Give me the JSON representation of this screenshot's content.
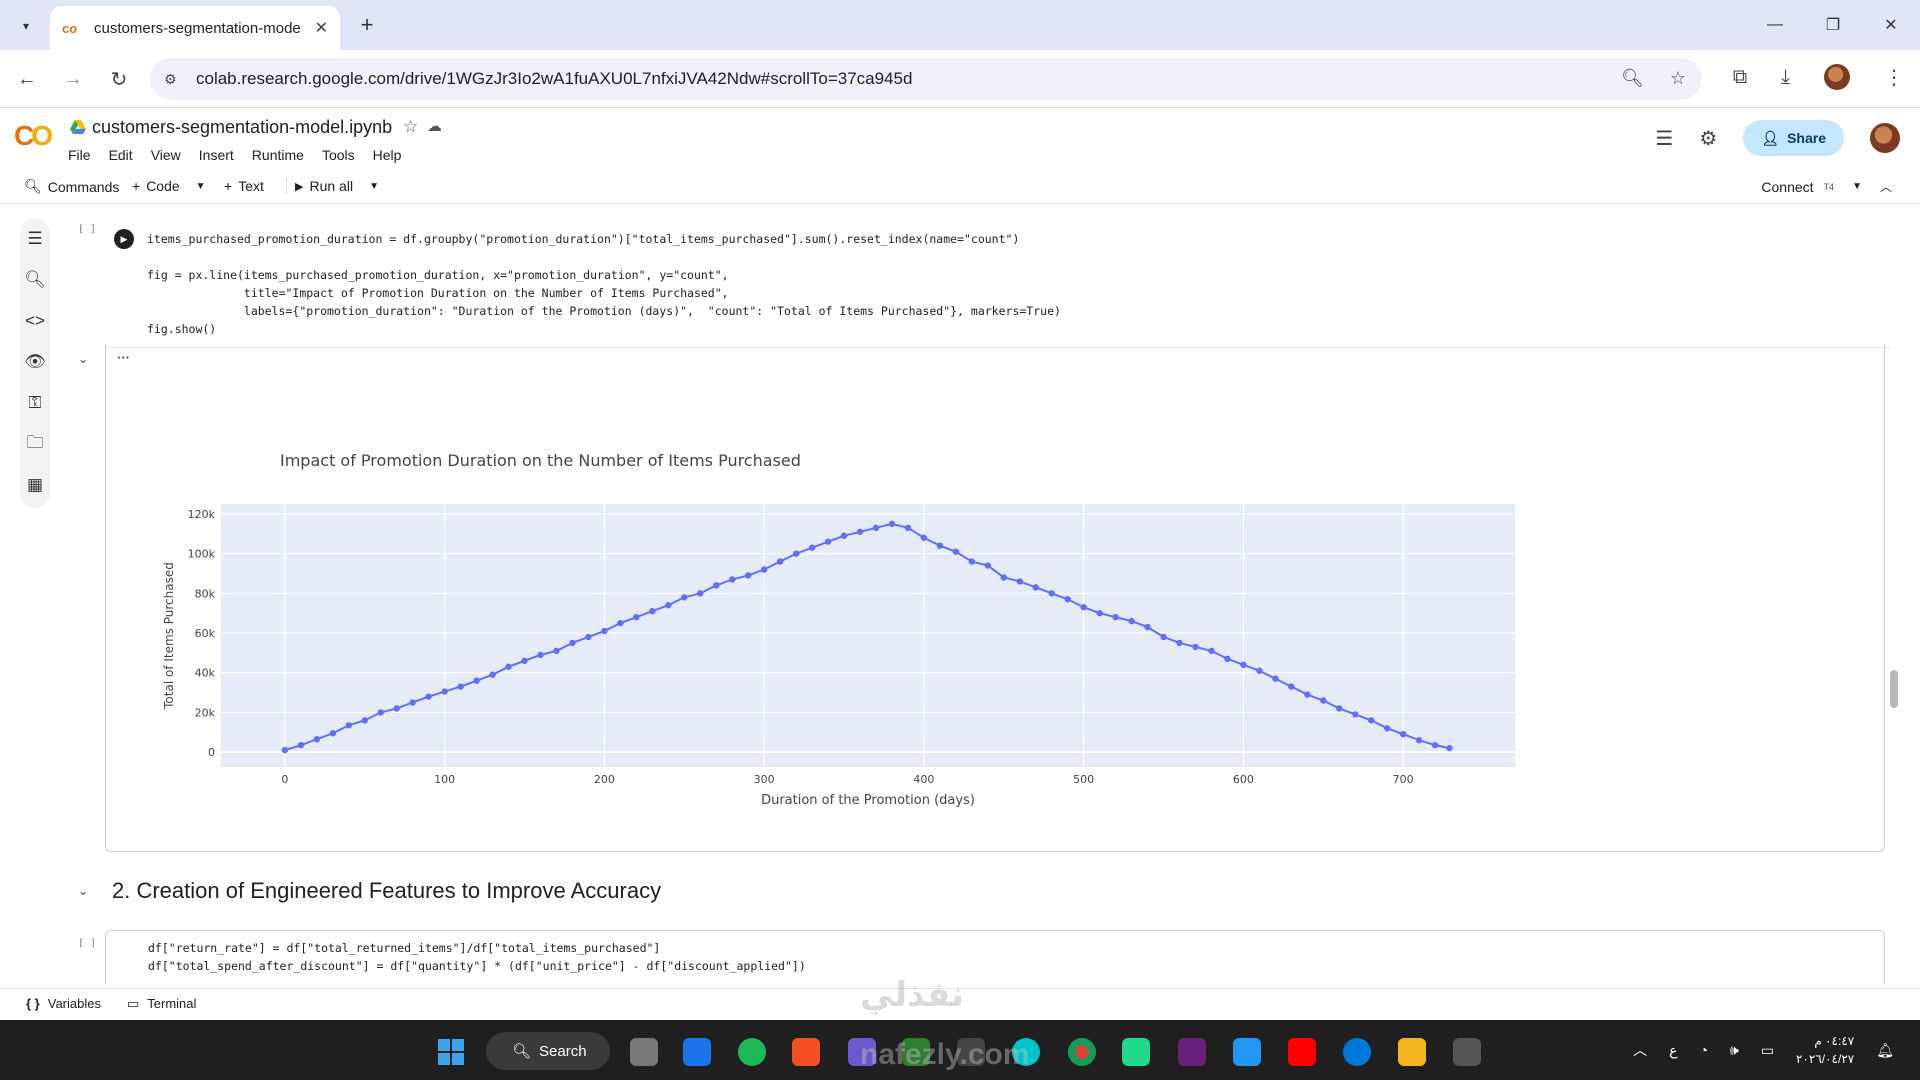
{
  "browser": {
    "tab_title": "customers-segmentation-mode",
    "url": "colab.research.google.com/drive/1WGzJr3Io2wA1fuAXU0L7nfxiJVA42Ndw#scrollTo=37ca945d"
  },
  "colab": {
    "notebook_title": "customers-segmentation-model.ipynb",
    "menu": [
      "File",
      "Edit",
      "View",
      "Insert",
      "Runtime",
      "Tools",
      "Help"
    ],
    "share_label": "Share",
    "toolbar": {
      "commands": "Commands",
      "code": "Code",
      "text": "Text",
      "run_all": "Run all",
      "connect": "Connect",
      "connect_sub": "T4"
    }
  },
  "cell1": {
    "bracket": "[ ]",
    "code_lines": [
      "items_purchased_promotion_duration = df.groupby(\"promotion_duration\")[\"total_items_purchased\"].sum().reset_index(name=\"count\")",
      "",
      "fig = px.line(items_purchased_promotion_duration, x=\"promotion_duration\", y=\"count\",",
      "              title=\"Impact of Promotion Duration on the Number of Items Purchased\",",
      "              labels={\"promotion_duration\": \"Duration of the Promotion (days)\",  \"count\": \"Total of Items Purchased\"}, markers=True)",
      "fig.show()"
    ]
  },
  "chart_data": {
    "type": "line",
    "title": "Impact of Promotion Duration on the Number of Items Purchased",
    "xlabel": "Duration of the Promotion (days)",
    "ylabel": "Total of Items Purchased",
    "xlim": [
      -40,
      770
    ],
    "ylim": [
      -7500,
      125000
    ],
    "x_ticks": [
      0,
      100,
      200,
      300,
      400,
      500,
      600,
      700
    ],
    "y_ticks": [
      0,
      20000,
      40000,
      60000,
      80000,
      100000,
      120000
    ],
    "y_tick_labels": [
      "0",
      "20k",
      "40k",
      "60k",
      "80k",
      "100k",
      "120k"
    ],
    "markers": true,
    "color": "#636efa",
    "grid": true,
    "background": "#e5ecf6",
    "series": [
      {
        "x": [
          0,
          10,
          20,
          30,
          40,
          50,
          60,
          70,
          80,
          90,
          100,
          110,
          120,
          130,
          140,
          150,
          160,
          170,
          180,
          190,
          200,
          210,
          220,
          230,
          240,
          250,
          260,
          270,
          280,
          290,
          300,
          310,
          320,
          330,
          340,
          350,
          360,
          370,
          380,
          390,
          400,
          410,
          420,
          430,
          440,
          450,
          460,
          470,
          480,
          490,
          500,
          510,
          520,
          530,
          540,
          550,
          560,
          570,
          580,
          590,
          600,
          610,
          620,
          630,
          640,
          650,
          660,
          670,
          680,
          690,
          700,
          710,
          720,
          729
        ],
        "values": [
          1000,
          3500,
          6500,
          9500,
          13500,
          16000,
          20000,
          22000,
          25000,
          28000,
          30500,
          33000,
          36000,
          39000,
          43000,
          46000,
          49000,
          51000,
          55000,
          58000,
          61000,
          65000,
          68000,
          71000,
          74000,
          78000,
          80000,
          84000,
          87000,
          89000,
          92000,
          96000,
          100000,
          103000,
          106000,
          109000,
          111000,
          113000,
          115000,
          113000,
          108000,
          104000,
          101000,
          96000,
          94000,
          88000,
          86000,
          83000,
          80000,
          77000,
          73000,
          70000,
          68000,
          66000,
          63000,
          58000,
          55000,
          53000,
          51000,
          47000,
          44000,
          41000,
          37000,
          33000,
          29000,
          26000,
          22000,
          19000,
          16000,
          12000,
          9000,
          6000,
          3500,
          2000
        ]
      }
    ]
  },
  "section": {
    "title": "2. Creation of Engineered Features to Improve Accuracy"
  },
  "cell2": {
    "bracket": "[ ]",
    "code_lines": [
      "df[\"return_rate\"] = df[\"total_returned_items\"]/df[\"total_items_purchased\"]",
      "df[\"total_spend_after_discount\"] = df[\"quantity\"] * (df[\"unit_price\"] - df[\"discount_applied\"])"
    ]
  },
  "bottom_bar": {
    "variables": "Variables",
    "terminal": "Terminal"
  },
  "taskbar": {
    "search": "Search",
    "clock_time": "٠٤:٤٧ م",
    "clock_date": "٢٠٢٦/٠٤/٢٧",
    "lang": "ع"
  },
  "watermark": {
    "arabic": "نفذلي",
    "latin": "nafezly.com"
  },
  "colors": {
    "accent": "#636efa",
    "plot_bg": "#e5ecf6",
    "share_bg": "#c2e7ff",
    "tab_strip": "#dfe7f5"
  }
}
